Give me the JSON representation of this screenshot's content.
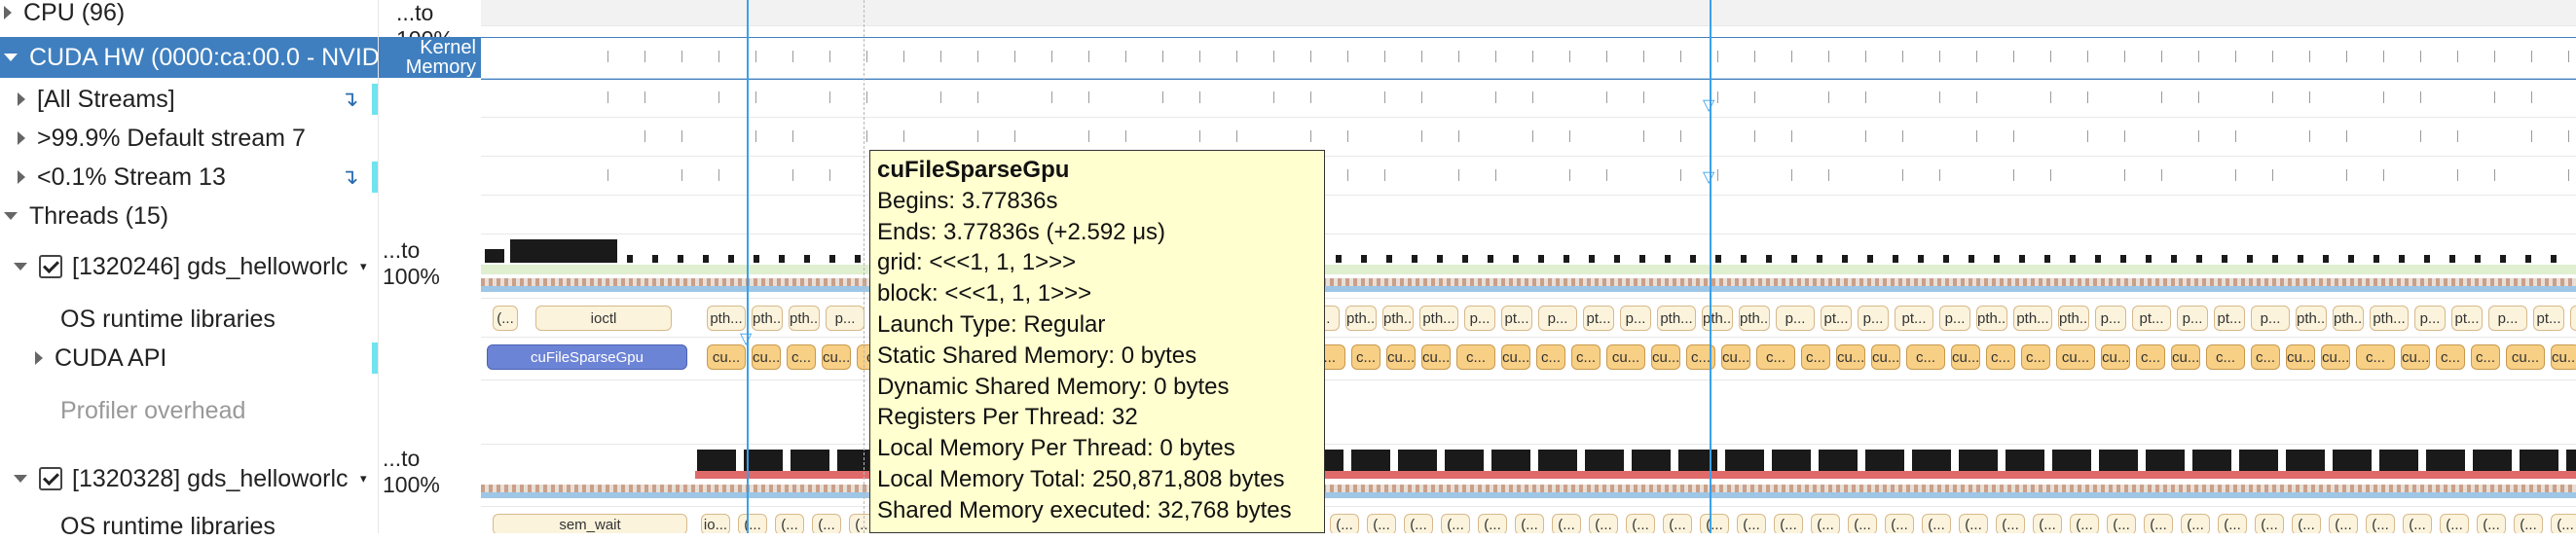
{
  "rows": {
    "cpu": "CPU (96)",
    "cuda_hw": "CUDA HW (0000:ca:00.0 - NVID",
    "all_streams": "[All Streams]",
    "default_stream": ">99.9% Default stream 7",
    "stream13": "<0.1% Stream 13",
    "threads": "Threads (15)",
    "thread1": "[1320246] gds_helloworlc",
    "os_runtime1": "OS runtime libraries",
    "cuda_api": "CUDA API",
    "profiler_overhead": "Profiler overhead",
    "thread2": "[1320328] gds_helloworlc",
    "os_runtime2": "OS runtime libraries"
  },
  "mid": {
    "cpu_pct": "...to 100%",
    "kernel_memory_line1": "Kernel",
    "kernel_memory_line2": "Memory",
    "thread1_pct": "...to 100%",
    "thread2_pct": "...to 100%"
  },
  "timeline": {
    "ioctl_label": "ioctl",
    "cufile_label": "cuFileSparseGpu",
    "sem_wait_label": "sem_wait",
    "pth": "pth...",
    "pt": "pt...",
    "p": "p...",
    "cu": "cu...",
    "c": "c...",
    "cu_short": "cu..",
    "cuu": "cu...",
    "io": "io...",
    "bracket": "(..."
  },
  "tooltip": {
    "title": "cuFileSparseGpu",
    "begins": "Begins: 3.77836s",
    "ends": "Ends: 3.77836s (+2.592 μs)",
    "grid": "grid:  <<<1, 1, 1>>>",
    "block": "block: <<<1, 1, 1>>>",
    "launch_type": "Launch Type: Regular",
    "static_shared": "Static Shared Memory: 0 bytes",
    "dynamic_shared": "Dynamic Shared Memory: 0 bytes",
    "registers": "Registers Per Thread: 32",
    "local_per_thread": "Local Memory Per Thread: 0 bytes",
    "local_total": "Local Memory Total: 250,871,808 bytes",
    "shared_executed": "Shared Memory executed: 32,768 bytes"
  },
  "colors": {
    "selected_row": "#3f7fbf",
    "cursor_line": "#3aa0ea",
    "tooltip_bg": "#ffffcf",
    "accent_cyan": "#6fe3ee"
  }
}
